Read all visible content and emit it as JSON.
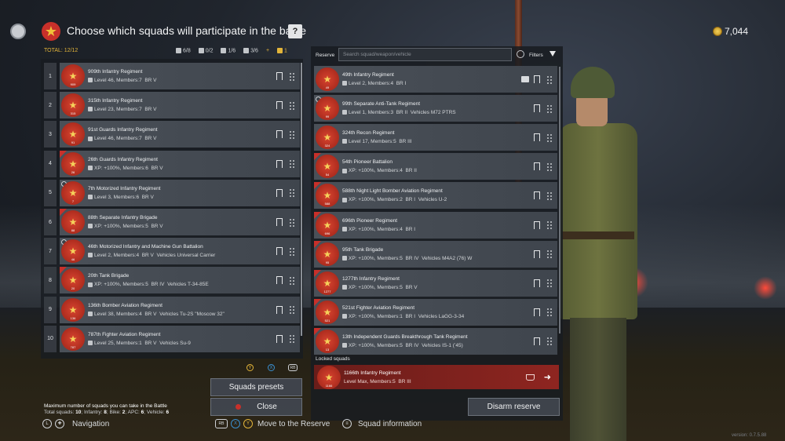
{
  "header": {
    "title": "Choose which squads will participate in the battle",
    "help_label": "?",
    "currency": "7,044"
  },
  "summary": {
    "total_label": "TOTAL: 12/12",
    "counts": [
      "6/8",
      "0/2",
      "1/6",
      "3/6",
      "+",
      "1"
    ]
  },
  "left_rows": [
    {
      "index": "1",
      "name": "909th Infantry Regiment",
      "meta": "Level 46, Members:7",
      "br": "BR V",
      "vehicle": "",
      "badge_num": "909",
      "flag": false,
      "round_mark": false
    },
    {
      "index": "2",
      "name": "315th Infantry Regiment",
      "meta": "Level 23, Members:7",
      "br": "BR V",
      "vehicle": "",
      "badge_num": "315",
      "flag": false,
      "round_mark": false
    },
    {
      "index": "3",
      "name": "91st Guards Infantry Regiment",
      "meta": "Level 46, Members:7",
      "br": "BR V",
      "vehicle": "",
      "badge_num": "91",
      "flag": false,
      "round_mark": false
    },
    {
      "index": "4",
      "name": "26th Guards Infantry Regiment",
      "meta": "XP: +100%, Members:6",
      "br": "BR V",
      "vehicle": "",
      "badge_num": "26",
      "flag": true,
      "round_mark": false
    },
    {
      "index": "5",
      "name": "7th Motorized Infantry Regiment",
      "meta": "Level 3, Members:6",
      "br": "BR V",
      "vehicle": "",
      "badge_num": "7",
      "flag": false,
      "round_mark": true
    },
    {
      "index": "6",
      "name": "88th Separate Infantry Brigade",
      "meta": "XP: +100%, Members:5",
      "br": "BR V",
      "vehicle": "",
      "badge_num": "88",
      "flag": true,
      "round_mark": false
    },
    {
      "index": "7",
      "name": "46th Motorized Infantry and Machine Gun Battalion",
      "meta": "Level 2, Members:4",
      "br": "BR V",
      "vehicle": "Vehicles Universal Carrier",
      "badge_num": "46",
      "flag": false,
      "round_mark": true
    },
    {
      "index": "8",
      "name": "20th Tank Brigade",
      "meta": "XP: +100%, Members:5",
      "br": "BR IV",
      "vehicle": "Vehicles T-34-85E",
      "badge_num": "20",
      "flag": true,
      "round_mark": false
    },
    {
      "index": "9",
      "name": "136th Bomber Aviation Regiment",
      "meta": "Level 38, Members:4",
      "br": "BR V",
      "vehicle": "Vehicles Tu-2S \"Moscow 32\"",
      "badge_num": "136",
      "flag": false,
      "round_mark": false
    },
    {
      "index": "10",
      "name": "787th Fighter Aviation Regiment",
      "meta": "Level 25, Members:1",
      "br": "BR V",
      "vehicle": "Vehicles Su-9",
      "badge_num": "787",
      "flag": false,
      "round_mark": false
    }
  ],
  "reserve": {
    "label": "Reserve",
    "search_placeholder": "Search squad/weapon/vehicle",
    "filters_label": "Filters",
    "locked_label": "Locked squads",
    "disarm_label": "Disarm reserve",
    "rows": [
      {
        "name": "49th Infantry Regiment",
        "meta": "Level 2, Members:4",
        "br": "BR I",
        "vehicle": "",
        "badge_num": "49",
        "flag": false,
        "round_mark": false,
        "book": true
      },
      {
        "name": "99th Separate Anti-Tank Regiment",
        "meta": "Level 1, Members:3",
        "br": "BR II",
        "vehicle": "Vehicles M72 PTRS",
        "badge_num": "99",
        "flag": false,
        "round_mark": true,
        "book": false
      },
      {
        "name": "324th Recon Regiment",
        "meta": "Level 17, Members:5",
        "br": "BR III",
        "vehicle": "",
        "badge_num": "324",
        "flag": false,
        "round_mark": false,
        "book": false
      },
      {
        "name": "54th Pioneer Battalion",
        "meta": "XP: +100%, Members:4",
        "br": "BR II",
        "vehicle": "",
        "badge_num": "54",
        "flag": true,
        "round_mark": false,
        "book": false
      },
      {
        "name": "588th Night Light Bomber Aviation Regiment",
        "meta": "XP: +100%, Members:2",
        "br": "BR I",
        "vehicle": "Vehicles U-2",
        "badge_num": "588",
        "flag": true,
        "round_mark": false,
        "book": false
      },
      {
        "name": "696th Pioneer Regiment",
        "meta": "XP: +100%, Members:4",
        "br": "BR I",
        "vehicle": "",
        "badge_num": "696",
        "flag": true,
        "round_mark": false,
        "book": false
      },
      {
        "name": "95th Tank Brigade",
        "meta": "XP: +100%, Members:5",
        "br": "BR IV",
        "vehicle": "Vehicles M4A2 (76) W",
        "badge_num": "95",
        "flag": true,
        "round_mark": false,
        "book": false
      },
      {
        "name": "1277th Infantry Regiment",
        "meta": "XP: +100%, Members:5",
        "br": "BR V",
        "vehicle": "",
        "badge_num": "1277",
        "flag": true,
        "round_mark": false,
        "book": false
      },
      {
        "name": "521st Fighter Aviation Regiment",
        "meta": "XP: +100%, Members:1",
        "br": "BR I",
        "vehicle": "Vehicles LaGG-3-34",
        "badge_num": "521",
        "flag": true,
        "round_mark": false,
        "book": false
      },
      {
        "name": "13th Independent Guards Breakthrough Tank Regiment",
        "meta": "XP: +100%, Members:5",
        "br": "BR IV",
        "vehicle": "Vehicles IS-1 (’45)",
        "badge_num": "13",
        "flag": true,
        "round_mark": false,
        "book": false
      }
    ],
    "locked": {
      "name": "1166th Infantry Regiment",
      "meta": "Level Max, Members:5",
      "br": "BR III",
      "badge_num": "1166"
    }
  },
  "buttons": {
    "presets": "Squads presets",
    "close": "Close"
  },
  "limits": {
    "title": "Maximum number of squads you can take in the Battle",
    "total_label": "Total squads:",
    "total_value": "10",
    "infantry_label": "; Infantry:",
    "infantry_value": "8",
    "bike_label": "; Bike:",
    "bike_value": "2",
    "apc_label": "; APC:",
    "apc_value": "6",
    "vehicle_label": "; Vehicle:",
    "vehicle_value": "6"
  },
  "hints": {
    "nav_key": "L",
    "navigation": "Navigation",
    "rb_key": "RB",
    "x_key": "X",
    "y_key": "Y",
    "move_to_reserve": "Move to the Reserve",
    "squad_info": "Squad information"
  },
  "controller_icons": [
    "Y",
    "X",
    "RB"
  ],
  "version": "version: 0.7.5.88",
  "colors": {
    "accent_red": "#c8302a",
    "accent_gold": "#e2b43a",
    "locked_red": "#8e2520"
  }
}
